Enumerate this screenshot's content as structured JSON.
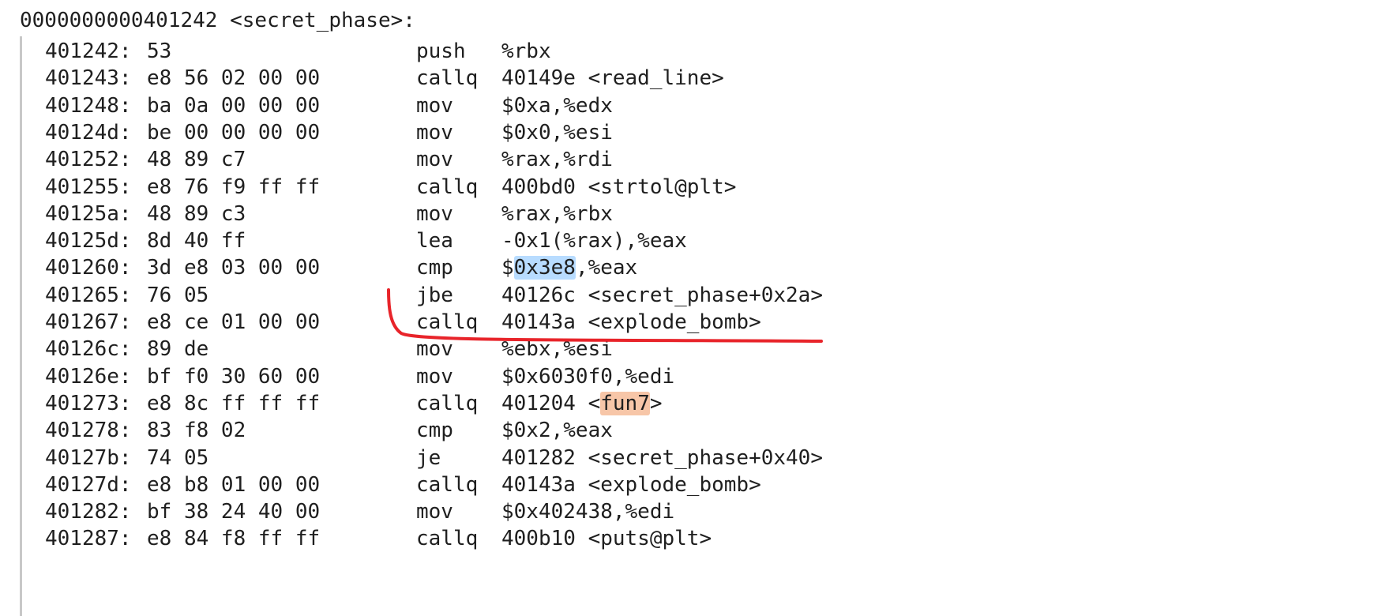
{
  "function_header": "0000000000401242 <secret_phase>:",
  "colors": {
    "text": "#1f1f1f",
    "highlight_blue": "#b8dcff",
    "highlight_orange": "#f7c6a8",
    "annotation_red": "#e8242a",
    "gutter_line": "#c8c8c8"
  },
  "rows": [
    {
      "addr": "401242:",
      "bytes": "53",
      "mnem": "push",
      "ops": "%rbx"
    },
    {
      "addr": "401243:",
      "bytes": "e8 56 02 00 00",
      "mnem": "callq",
      "ops": "40149e <read_line>"
    },
    {
      "addr": "401248:",
      "bytes": "ba 0a 00 00 00",
      "mnem": "mov",
      "ops": "$0xa,%edx"
    },
    {
      "addr": "40124d:",
      "bytes": "be 00 00 00 00",
      "mnem": "mov",
      "ops": "$0x0,%esi"
    },
    {
      "addr": "401252:",
      "bytes": "48 89 c7",
      "mnem": "mov",
      "ops": "%rax,%rdi"
    },
    {
      "addr": "401255:",
      "bytes": "e8 76 f9 ff ff",
      "mnem": "callq",
      "ops": "400bd0 <strtol@plt>"
    },
    {
      "addr": "40125a:",
      "bytes": "48 89 c3",
      "mnem": "mov",
      "ops": "%rax,%rbx"
    },
    {
      "addr": "40125d:",
      "bytes": "8d 40 ff",
      "mnem": "lea",
      "ops": "-0x1(%rax),%eax"
    },
    {
      "addr": "401260:",
      "bytes": "3d e8 03 00 00",
      "mnem": "cmp",
      "ops_pre": "$",
      "ops_hl": "0x3e8",
      "ops_post": ",%eax",
      "hl": "blue"
    },
    {
      "addr": "401265:",
      "bytes": "76 05",
      "mnem": "jbe",
      "ops": "40126c <secret_phase+0x2a>"
    },
    {
      "addr": "401267:",
      "bytes": "e8 ce 01 00 00",
      "mnem": "callq",
      "ops": "40143a <explode_bomb>"
    },
    {
      "addr": "40126c:",
      "bytes": "89 de",
      "mnem": "mov",
      "ops": "%ebx,%esi"
    },
    {
      "addr": "40126e:",
      "bytes": "bf f0 30 60 00",
      "mnem": "mov",
      "ops": "$0x6030f0,%edi"
    },
    {
      "addr": "401273:",
      "bytes": "e8 8c ff ff ff",
      "mnem": "callq",
      "ops_pre": "401204 <",
      "ops_hl": "fun7",
      "ops_post": ">",
      "hl": "orange"
    },
    {
      "addr": "401278:",
      "bytes": "83 f8 02",
      "mnem": "cmp",
      "ops": "$0x2,%eax"
    },
    {
      "addr": "40127b:",
      "bytes": "74 05",
      "mnem": "je",
      "ops": "401282 <secret_phase+0x40>"
    },
    {
      "addr": "40127d:",
      "bytes": "e8 b8 01 00 00",
      "mnem": "callq",
      "ops": "40143a <explode_bomb>"
    },
    {
      "addr": "401282:",
      "bytes": "bf 38 24 40 00",
      "mnem": "mov",
      "ops": "$0x402438,%edi"
    },
    {
      "addr": "401287:",
      "bytes": "e8 84 f8 ff ff",
      "mnem": "callq",
      "ops": "400b10 <puts@plt>"
    }
  ]
}
